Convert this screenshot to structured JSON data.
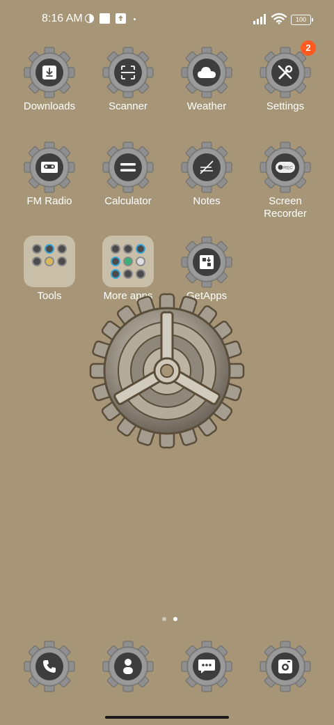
{
  "status_bar": {
    "time": "8:16 AM",
    "battery": "100",
    "icons": [
      "data-saver-icon",
      "notification-square-icon",
      "upload-icon",
      "signal-icon",
      "wifi-icon",
      "battery-icon"
    ]
  },
  "apps": [
    {
      "label": "Downloads",
      "icon": "download-icon"
    },
    {
      "label": "Scanner",
      "icon": "scanner-icon"
    },
    {
      "label": "Weather",
      "icon": "cloud-icon"
    },
    {
      "label": "Settings",
      "icon": "wrench-screwdriver-icon",
      "badge": "2"
    },
    {
      "label": "FM Radio",
      "icon": "cassette-icon"
    },
    {
      "label": "Calculator",
      "icon": "equals-icon"
    },
    {
      "label": "Notes",
      "icon": "note-pen-icon"
    },
    {
      "label": "Screen Recorder",
      "icon": "rec-icon",
      "rec_text": "REC"
    },
    {
      "label": "Tools",
      "icon": "folder-icon"
    },
    {
      "label": "More apps",
      "icon": "folder-icon"
    },
    {
      "label": "GetApps",
      "icon": "getapps-icon"
    }
  ],
  "dock": [
    {
      "icon": "phone-icon"
    },
    {
      "icon": "contacts-icon"
    },
    {
      "icon": "messages-icon"
    },
    {
      "icon": "camera-icon"
    }
  ],
  "pager": {
    "pages": 2,
    "current": 2
  },
  "colors": {
    "background": "#a69677",
    "badge": "#ff5a1f",
    "icon_inner": "#3d3d3d",
    "gear": "#8f8f8f"
  }
}
